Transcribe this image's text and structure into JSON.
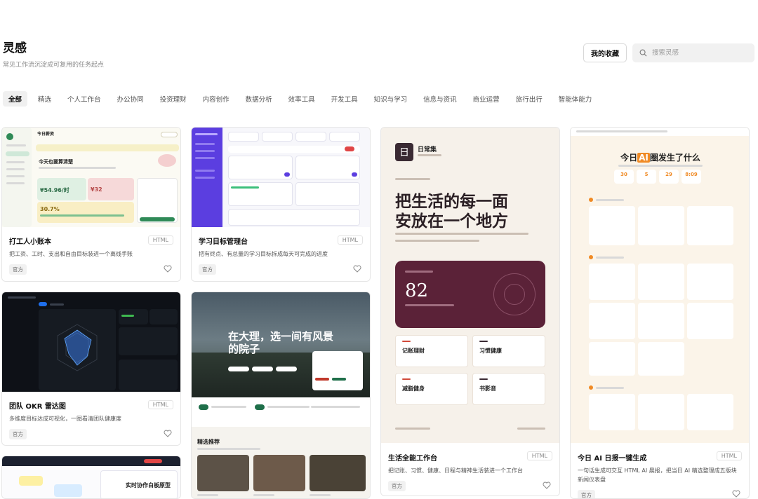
{
  "header": {
    "title": "灵感",
    "subtitle": "常见工作流沉淀成可复用的任务起点",
    "fav_label": "我的收藏",
    "search_placeholder": "搜索灵感"
  },
  "tabs": [
    "全部",
    "精选",
    "个人工作台",
    "办公协同",
    "投资理财",
    "内容创作",
    "数据分析",
    "效率工具",
    "开发工具",
    "知识与学习",
    "信息与资讯",
    "商业运营",
    "旅行出行",
    "智能体能力"
  ],
  "cards": [
    {
      "title": "打工人小账本",
      "badge": "HTML",
      "desc": "把工资、工时、支出和自由目标装进一个离线手账",
      "tag": "官方"
    },
    {
      "title": "学习目标管理台",
      "badge": "HTML",
      "desc": "把有终点、有总量的学习目标拆成每天可完成的进度",
      "tag": "官方"
    },
    {
      "title": "生活全能工作台",
      "badge": "HTML",
      "desc": "把记账、习惯、健康、日程与精神生活装进一个工作台",
      "tag": "官方"
    },
    {
      "title": "今日 AI 日报一键生成",
      "badge": "HTML",
      "desc": "一句话生成可交互 HTML AI 晨报，把当日 AI 精选整理成五版块新闻仪表盘",
      "tag": "官方"
    },
    {
      "title": "团队 OKR 雷达图",
      "badge": "HTML",
      "desc": "多维度目标达成可视化，一图看清团队健康度",
      "tag": "官方"
    }
  ],
  "thumbs": {
    "ledger": {
      "heading1": "今日薪资",
      "heading2": "今天也要算清楚",
      "value1": "¥54.96/时",
      "value2": "¥32",
      "value3": "30.7%"
    },
    "life": {
      "brand": "日常集",
      "headline1": "把生活的每一面",
      "headline2": "安放在一个地方",
      "score": "82",
      "item1": "记账理财",
      "item2": "习惯健康",
      "item3": "减脂健身",
      "item4": "书影音"
    },
    "ai": {
      "headline_pre": "今日",
      "headline_ai": "AI",
      "headline_post": "圈发生了什么",
      "stat1": "30",
      "stat2": "5",
      "stat3": "29",
      "stat4": "8:09"
    },
    "travel": {
      "headline1": "在大理，选一间有风景",
      "headline2": "的院子",
      "section": "精选推荐"
    },
    "collab": {
      "title": "实时协作白板原型"
    }
  },
  "colors": {
    "accent": "#111111",
    "life_card": "#5b2238",
    "ai_orange": "#f08a24",
    "travel_green": "#1f6f4a",
    "okr_bg": "#0e1117"
  }
}
